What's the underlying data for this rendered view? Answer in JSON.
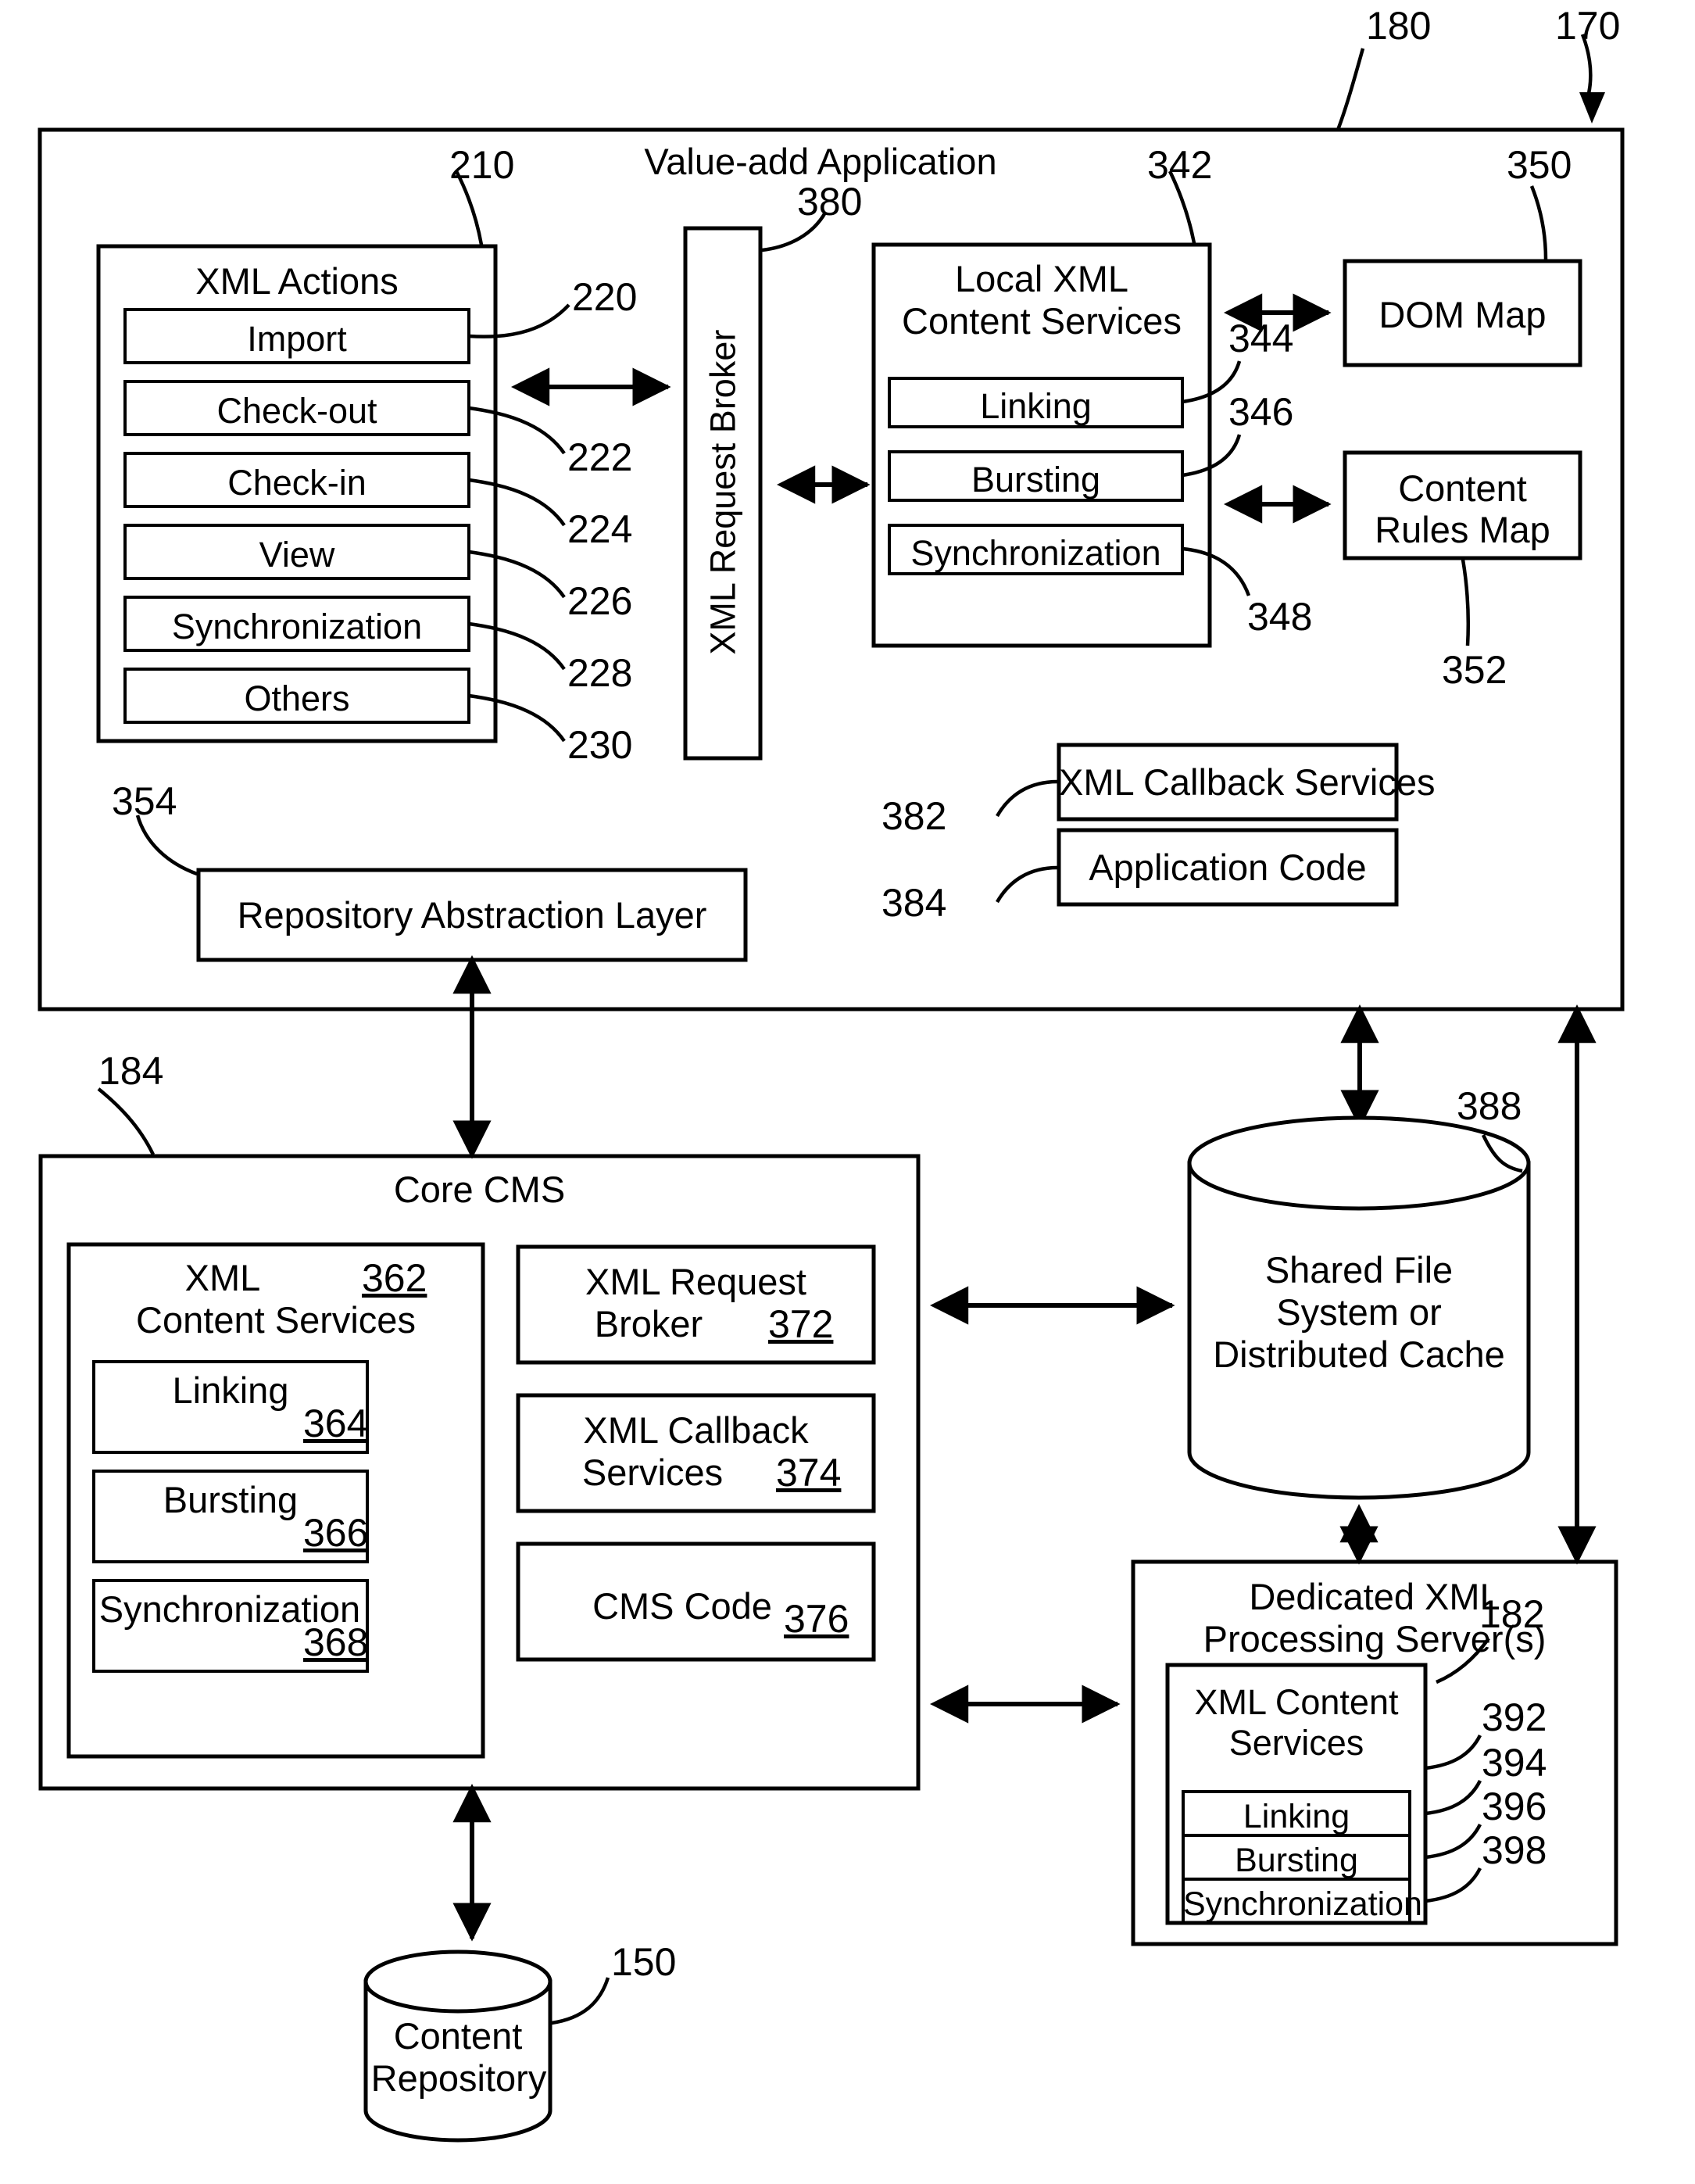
{
  "figure": {
    "type": "patent-block-diagram",
    "outer_ref": "170",
    "value_add_app": {
      "title": "Value-add Application",
      "ref_top": "180",
      "xml_actions": {
        "title": "XML Actions",
        "ref": "210",
        "items": [
          {
            "label": "Import",
            "ref": "220"
          },
          {
            "label": "Check-out",
            "ref": "222"
          },
          {
            "label": "Check-in",
            "ref": "224"
          },
          {
            "label": "View",
            "ref": "226"
          },
          {
            "label": "Synchronization",
            "ref": "228"
          },
          {
            "label": "Others",
            "ref": "230"
          }
        ]
      },
      "xml_request_broker": {
        "label": "XML Request Broker",
        "ref": "380"
      },
      "local_xml_content_services": {
        "title_line1": "Local XML",
        "title_line2": "Content Services",
        "ref": "342",
        "items": [
          {
            "label": "Linking",
            "ref": "344"
          },
          {
            "label": "Bursting",
            "ref": "346"
          },
          {
            "label": "Synchronization",
            "ref": "348"
          }
        ]
      },
      "dom_map": {
        "label": "DOM Map",
        "ref": "350"
      },
      "content_rules_map": {
        "line1": "Content",
        "line2": "Rules Map",
        "ref": "352"
      },
      "xml_callback_services": {
        "label": "XML Callback Services",
        "ref": "382"
      },
      "application_code": {
        "label": "Application Code",
        "ref": "384"
      },
      "repository_abstraction_layer": {
        "label": "Repository Abstraction Layer",
        "ref": "354"
      }
    },
    "core_cms": {
      "title": "Core CMS",
      "ref": "184",
      "xml_content_services": {
        "title_line1": "XML",
        "title_line2": "Content Services",
        "ref": "362",
        "items": [
          {
            "label": "Linking",
            "ref": "364"
          },
          {
            "label": "Bursting",
            "ref": "366"
          },
          {
            "label": "Synchronization",
            "ref": "368"
          }
        ]
      },
      "right_items": [
        {
          "line1": "XML Request",
          "line2": "Broker",
          "ref": "372"
        },
        {
          "line1": "XML Callback",
          "line2": "Services",
          "ref": "374"
        },
        {
          "line1": "CMS Code",
          "line2": "",
          "ref": "376"
        }
      ]
    },
    "shared_store": {
      "line1": "Shared File",
      "line2": "System or",
      "line3": "Distributed Cache",
      "ref": "388"
    },
    "dedicated_server": {
      "title_line1": "Dedicated XML",
      "title_line2": "Processing Server(s)",
      "ref": "182",
      "xml_content_services": {
        "title_line1": "XML Content",
        "title_line2": "Services",
        "ref": "392",
        "items": [
          {
            "label": "Linking",
            "ref": "394"
          },
          {
            "label": "Bursting",
            "ref": "396"
          },
          {
            "label": "Synchronization",
            "ref": "398"
          }
        ]
      }
    },
    "content_repository": {
      "line1": "Content",
      "line2": "Repository",
      "ref": "150"
    }
  }
}
